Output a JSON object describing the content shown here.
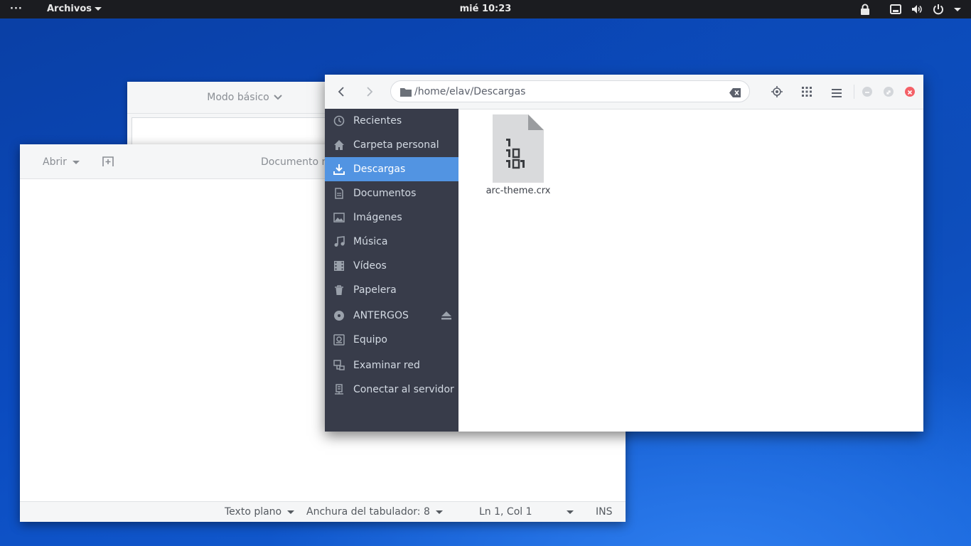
{
  "topbar": {
    "activities": "···",
    "app_menu": "Archivos",
    "clock": "mié 10:23",
    "tray_icons": [
      "lock-icon",
      "network-icon",
      "volume-icon",
      "power-icon",
      "chevron-down-icon"
    ]
  },
  "calculator": {
    "mode_label": "Modo básico"
  },
  "editor": {
    "open_label": "Abrir",
    "title": "Documento n",
    "status": {
      "syntax": "Texto plano",
      "tab_width": "Anchura del tabulador: 8",
      "position": "Ln 1, Col 1",
      "mode": "INS"
    }
  },
  "files": {
    "path": "/home/elav/Descargas",
    "sidebar": [
      {
        "label": "Recientes",
        "icon": "clock-icon"
      },
      {
        "label": "Carpeta personal",
        "icon": "home-icon"
      },
      {
        "label": "Descargas",
        "icon": "download-icon",
        "active": true
      },
      {
        "label": "Documentos",
        "icon": "document-icon"
      },
      {
        "label": "Imágenes",
        "icon": "image-icon"
      },
      {
        "label": "Música",
        "icon": "music-icon"
      },
      {
        "label": "Vídeos",
        "icon": "video-icon"
      },
      {
        "label": "Papelera",
        "icon": "trash-icon"
      },
      {
        "label": "ANTERGOS",
        "icon": "disc-icon"
      },
      {
        "label": "Equipo",
        "icon": "computer-icon"
      },
      {
        "label": "Examinar red",
        "icon": "network-icon"
      },
      {
        "label": "Conectar al servidor",
        "icon": "server-icon"
      }
    ],
    "items": [
      {
        "name": "arc-theme.crx",
        "icon": "binary-file-icon"
      }
    ],
    "colors": {
      "sidebar_bg": "#383c4a",
      "accent": "#5294e2",
      "close": "#f46067"
    }
  }
}
